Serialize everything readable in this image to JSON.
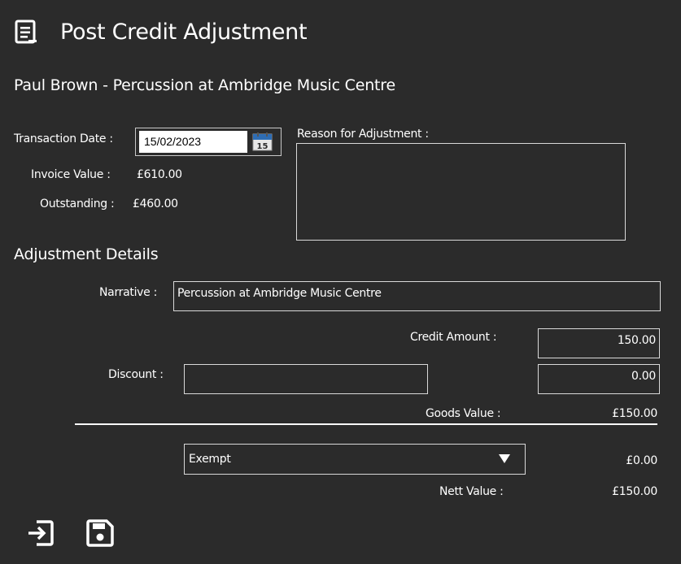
{
  "page": {
    "title": "Post Credit Adjustment",
    "title_icon": "document-list-icon",
    "student_line": "Paul Brown  -  Percussion  at Ambridge Music Centre"
  },
  "transaction": {
    "date_label": "Transaction Date :",
    "date_value": "15/02/2023",
    "calendar_icon": "calendar-icon",
    "calendar_day": "15",
    "invoice_value_label": "Invoice Value  :",
    "invoice_value": "£610.00",
    "outstanding_label": "Outstanding :",
    "outstanding_value": "£460.00"
  },
  "reason": {
    "label": "Reason for Adjustment :",
    "value": ""
  },
  "adjustment": {
    "section_title": "Adjustment Details",
    "narrative_label": "Narrative :",
    "narrative_value": "Percussion  at Ambridge Music Centre",
    "credit_amount_label": "Credit Amount :",
    "credit_amount_value": "150.00",
    "discount_label": "Discount :",
    "discount_text_value": "",
    "discount_amount_value": "0.00",
    "goods_value_label": "Goods Value :",
    "goods_value": "£150.00",
    "vat_selected": "Exempt",
    "vat_amount": "£0.00",
    "nett_value_label": "Nett Value :",
    "nett_value": "£150.00"
  },
  "actions": {
    "exit_icon": "exit-icon",
    "save_icon": "save-icon"
  },
  "colors": {
    "background": "#2b2b2b",
    "text": "#ffffff",
    "border": "#d9d9d9",
    "calendar_blue": "#2e6db4"
  }
}
